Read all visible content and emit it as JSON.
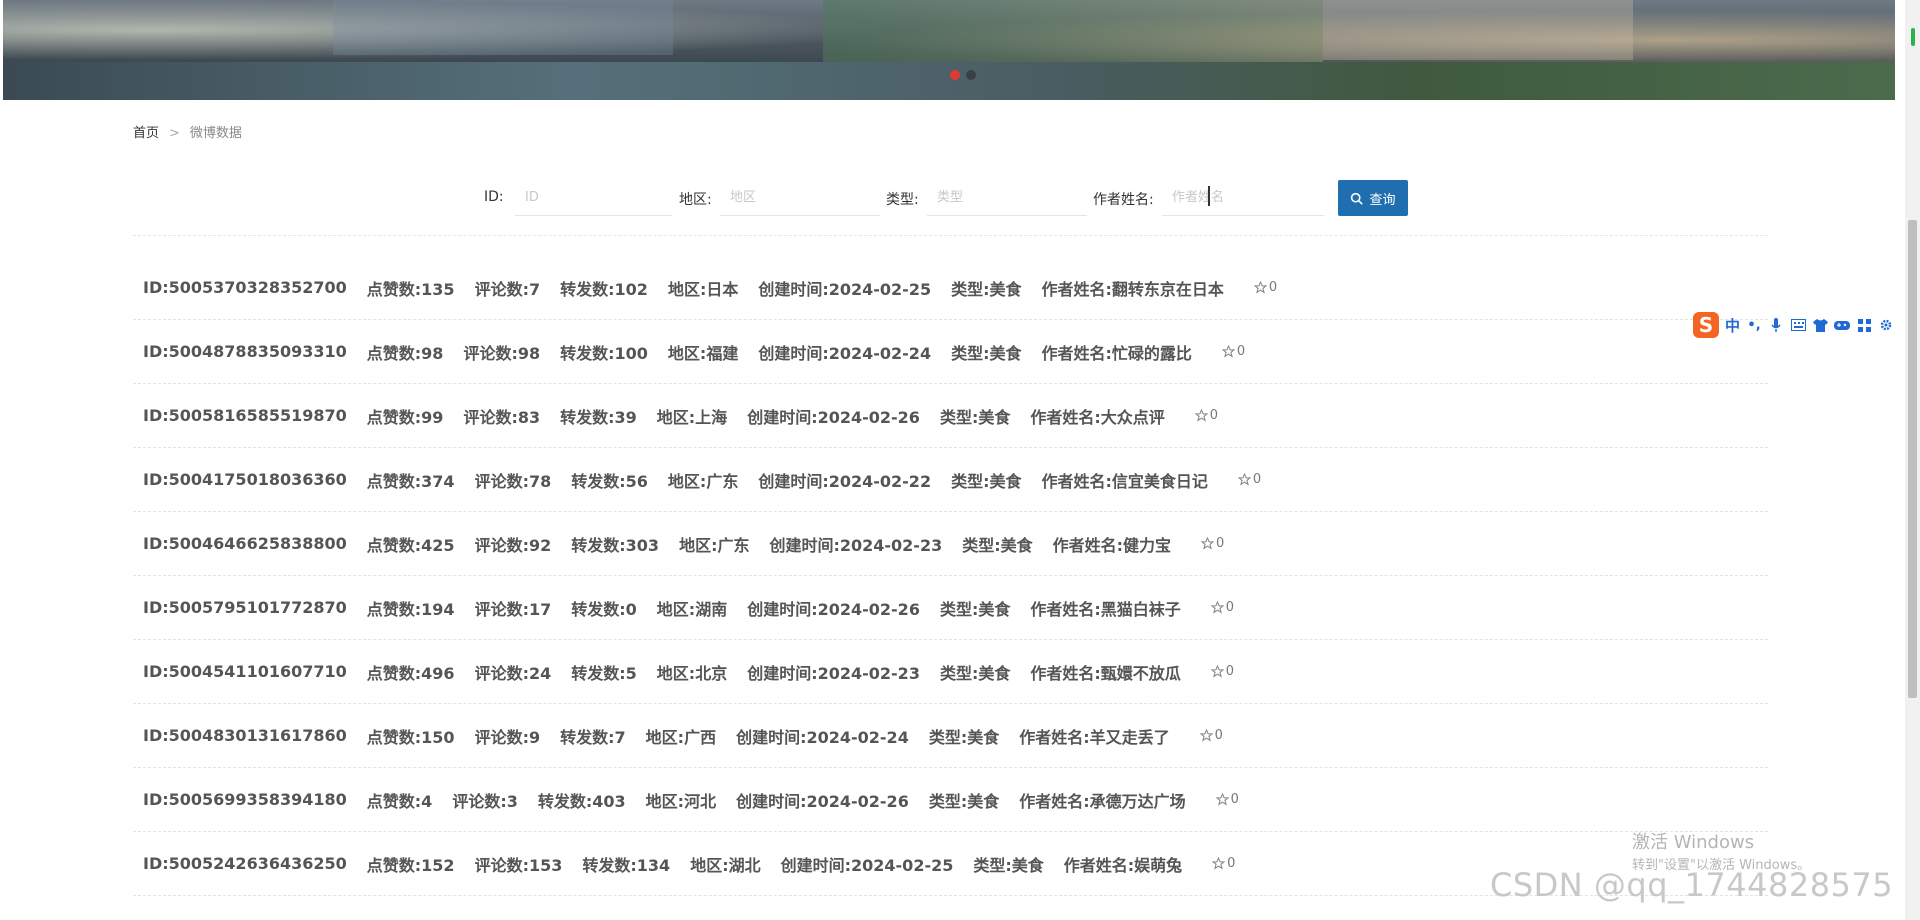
{
  "breadcrumb": {
    "home": "首页",
    "separator": ">",
    "current": "微博数据"
  },
  "search": {
    "id_label": "ID:",
    "id_placeholder": "ID",
    "region_label": "地区:",
    "region_placeholder": "地区",
    "type_label": "类型:",
    "type_placeholder": "类型",
    "author_label": "作者姓名:",
    "author_placeholder": "作者姓名",
    "button_label": "查询"
  },
  "rows": [
    {
      "id": "ID:5005370328352700",
      "likes": "点赞数:135",
      "comments": "评论数:7",
      "reposts": "转发数:102",
      "region": "地区:日本",
      "created": "创建时间:2024-02-25",
      "type": "类型:美食",
      "author": "作者姓名:翻转东京在日本",
      "fav": "0"
    },
    {
      "id": "ID:5004878835093310",
      "likes": "点赞数:98",
      "comments": "评论数:98",
      "reposts": "转发数:100",
      "region": "地区:福建",
      "created": "创建时间:2024-02-24",
      "type": "类型:美食",
      "author": "作者姓名:忙碌的露比",
      "fav": "0"
    },
    {
      "id": "ID:5005816585519870",
      "likes": "点赞数:99",
      "comments": "评论数:83",
      "reposts": "转发数:39",
      "region": "地区:上海",
      "created": "创建时间:2024-02-26",
      "type": "类型:美食",
      "author": "作者姓名:大众点评",
      "fav": "0"
    },
    {
      "id": "ID:5004175018036360",
      "likes": "点赞数:374",
      "comments": "评论数:78",
      "reposts": "转发数:56",
      "region": "地区:广东",
      "created": "创建时间:2024-02-22",
      "type": "类型:美食",
      "author": "作者姓名:信宜美食日记",
      "fav": "0"
    },
    {
      "id": "ID:5004646625838800",
      "likes": "点赞数:425",
      "comments": "评论数:92",
      "reposts": "转发数:303",
      "region": "地区:广东",
      "created": "创建时间:2024-02-23",
      "type": "类型:美食",
      "author": "作者姓名:健力宝",
      "fav": "0"
    },
    {
      "id": "ID:5005795101772870",
      "likes": "点赞数:194",
      "comments": "评论数:17",
      "reposts": "转发数:0",
      "region": "地区:湖南",
      "created": "创建时间:2024-02-26",
      "type": "类型:美食",
      "author": "作者姓名:黑猫白袜子",
      "fav": "0"
    },
    {
      "id": "ID:5004541101607710",
      "likes": "点赞数:496",
      "comments": "评论数:24",
      "reposts": "转发数:5",
      "region": "地区:北京",
      "created": "创建时间:2024-02-23",
      "type": "类型:美食",
      "author": "作者姓名:甄嬛不放瓜",
      "fav": "0"
    },
    {
      "id": "ID:5004830131617860",
      "likes": "点赞数:150",
      "comments": "评论数:9",
      "reposts": "转发数:7",
      "region": "地区:广西",
      "created": "创建时间:2024-02-24",
      "type": "类型:美食",
      "author": "作者姓名:羊又走丢了",
      "fav": "0"
    },
    {
      "id": "ID:5005699358394180",
      "likes": "点赞数:4",
      "comments": "评论数:3",
      "reposts": "转发数:403",
      "region": "地区:河北",
      "created": "创建时间:2024-02-26",
      "type": "类型:美食",
      "author": "作者姓名:承德万达广场",
      "fav": "0"
    },
    {
      "id": "ID:5005242636436250",
      "likes": "点赞数:152",
      "comments": "评论数:153",
      "reposts": "转发数:134",
      "region": "地区:湖北",
      "created": "创建时间:2024-02-25",
      "type": "类型:美食",
      "author": "作者姓名:娱萌兔",
      "fav": "0"
    }
  ],
  "ime": {
    "logo": "S",
    "lang": "中"
  },
  "watermark": {
    "title": "激活 Windows",
    "subtitle": "转到\"设置\"以激活 Windows。",
    "csdn": "CSDN @qq_1744828575"
  },
  "colors": {
    "accent": "#1f6fb0",
    "carousel_active": "#e03a2f",
    "ime_logo": "#f26522"
  }
}
